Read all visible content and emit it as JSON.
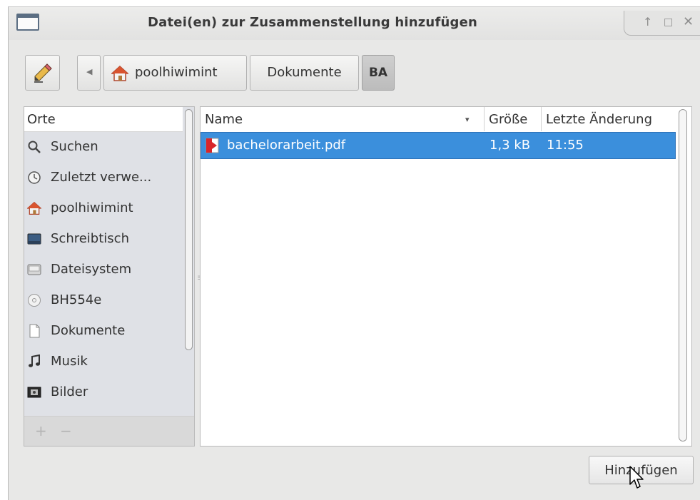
{
  "window": {
    "title": "Datei(en) zur Zusammenstellung hinzufügen",
    "controls": [
      "↑",
      "□",
      "✕"
    ]
  },
  "toolbar": {
    "edit_icon": "pencil-icon",
    "back_arrow": "◀",
    "breadcrumbs": [
      "poolhiwimint",
      "Dokumente",
      "BA"
    ]
  },
  "places": {
    "header": "Orte",
    "items": [
      {
        "label": "Suchen",
        "icon": "search-icon"
      },
      {
        "label": "Zuletzt verwe...",
        "icon": "recent-icon"
      },
      {
        "label": "poolhiwimint",
        "icon": "home-icon"
      },
      {
        "label": "Schreibtisch",
        "icon": "desktop-icon"
      },
      {
        "label": "Dateisystem",
        "icon": "filesystem-icon"
      },
      {
        "label": "BH554e",
        "icon": "disc-icon"
      },
      {
        "label": "Dokumente",
        "icon": "document-icon"
      },
      {
        "label": "Musik",
        "icon": "music-icon"
      },
      {
        "label": "Bilder",
        "icon": "pictures-icon"
      }
    ],
    "add_label": "+",
    "remove_label": "−"
  },
  "files": {
    "columns": [
      "Name",
      "Größe",
      "Letzte Änderung"
    ],
    "sort_indicator": "▾",
    "rows": [
      {
        "name": "bachelorarbeit.pdf",
        "size": "1,3 kB",
        "modified": "11:55",
        "icon": "pdf-icon",
        "selected": true
      }
    ]
  },
  "actions": {
    "add_button": "Hinzufügen"
  },
  "colors": {
    "selection": "#3b8fdc",
    "window_bg": "#e8e8e7",
    "sidebar_bg": "#dfe1e6"
  }
}
